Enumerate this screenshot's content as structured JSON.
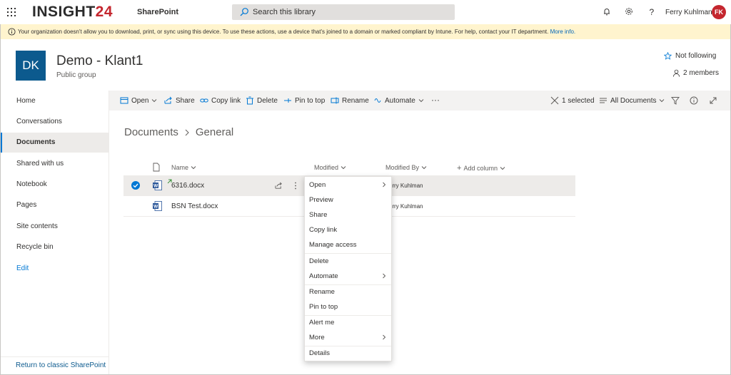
{
  "suite": {
    "logo_main": "INSIGHT",
    "logo_accent": "24",
    "app_name": "SharePoint",
    "search_placeholder": "Search this library",
    "user_name": "Ferry Kuhlman",
    "user_initials": "FK"
  },
  "warning": {
    "text": "Your organization doesn't allow you to download, print, or sync using this device. To use these actions, use a device that's joined to a domain or marked compliant by Intune. For help, contact your IT department.",
    "link": "More info."
  },
  "site": {
    "logo_initials": "DK",
    "title": "Demo - Klant1",
    "subtitle": "Public group",
    "follow_label": "Not following",
    "members_label": "2 members"
  },
  "nav": {
    "items": [
      {
        "label": "Home"
      },
      {
        "label": "Conversations"
      },
      {
        "label": "Documents"
      },
      {
        "label": "Shared with us"
      },
      {
        "label": "Notebook"
      },
      {
        "label": "Pages"
      },
      {
        "label": "Site contents"
      },
      {
        "label": "Recycle bin"
      },
      {
        "label": "Edit"
      }
    ],
    "selected_index": 2,
    "classic_link": "Return to classic SharePoint"
  },
  "commandbar": {
    "open": "Open",
    "share": "Share",
    "copy_link": "Copy link",
    "delete": "Delete",
    "pin_to_top": "Pin to top",
    "rename": "Rename",
    "automate": "Automate",
    "more": "···",
    "selected_count": "1 selected",
    "view": "All Documents"
  },
  "breadcrumb": {
    "root": "Documents",
    "current": "General"
  },
  "list": {
    "columns": {
      "name": "Name",
      "modified": "Modified",
      "modified_by": "Modified By",
      "add_column": "Add column"
    },
    "rows": [
      {
        "name": "6316.docx",
        "modified_by": "Ferry Kuhlman",
        "selected": true
      },
      {
        "name": "BSN Test.docx",
        "modified_by": "Ferry Kuhlman",
        "selected": false
      }
    ]
  },
  "context_menu": {
    "items": [
      "Open",
      "Preview",
      "Share",
      "Copy link",
      "Manage access",
      "Delete",
      "Automate",
      "Rename",
      "Pin to top",
      "Alert me",
      "More",
      "Details"
    ]
  },
  "colors": {
    "accent": "#0078d4",
    "brand_red": "#c4262e",
    "site_logo_bg": "#0c5a8e",
    "warning_bg": "#fff4ce",
    "command_bar_bg": "#f3f2f1"
  }
}
